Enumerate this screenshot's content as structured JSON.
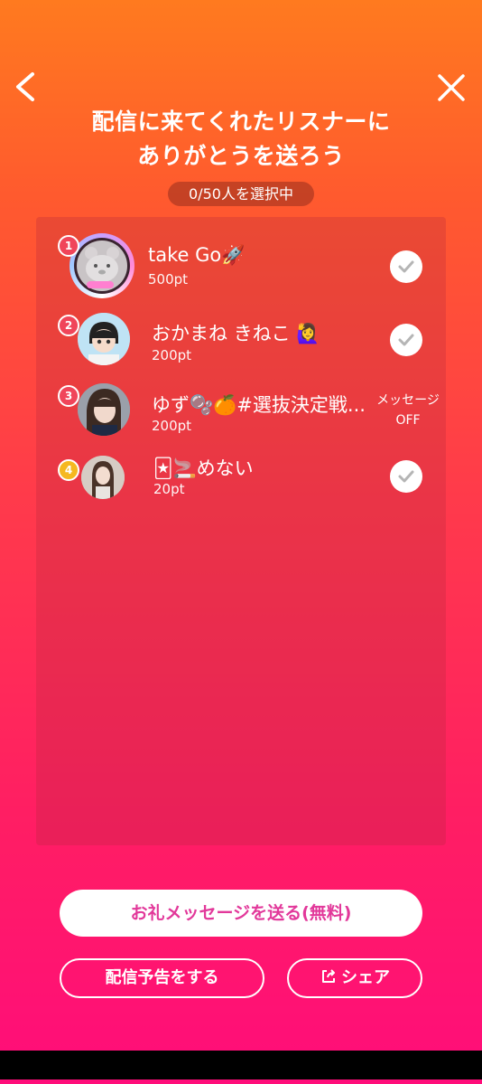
{
  "header": {
    "back_icon": "chevron-left-icon",
    "close_icon": "close-icon",
    "title_line1": "配信に来てくれたリスナーに",
    "title_line2": "ありがとうを送ろう",
    "counter": "0/50人を選択中"
  },
  "listeners": [
    {
      "rank": "1",
      "name": "take Go🚀",
      "points": "500pt",
      "action": "check"
    },
    {
      "rank": "2",
      "name": "おかまね きねこ 🙋‍♀️",
      "points": "200pt",
      "action": "check"
    },
    {
      "rank": "3",
      "name": "ゆず🫧🍊#選抜決定戦...",
      "points": "200pt",
      "action": "message-off",
      "message_label": "メッセージ",
      "message_state": "OFF"
    },
    {
      "rank": "4",
      "name": "🃏🚬めない",
      "points": "20pt",
      "action": "check"
    }
  ],
  "buttons": {
    "send_thanks": "お礼メッセージを送る(無料)",
    "announce": "配信予告をする",
    "share": "シェア",
    "share_icon": "share-icon"
  },
  "colors": {
    "rank1": "#f0455a",
    "rank2": "#f0455a",
    "rank3": "#f0455a",
    "rank4": "#f5b820",
    "primary_text": "#e2389a"
  }
}
